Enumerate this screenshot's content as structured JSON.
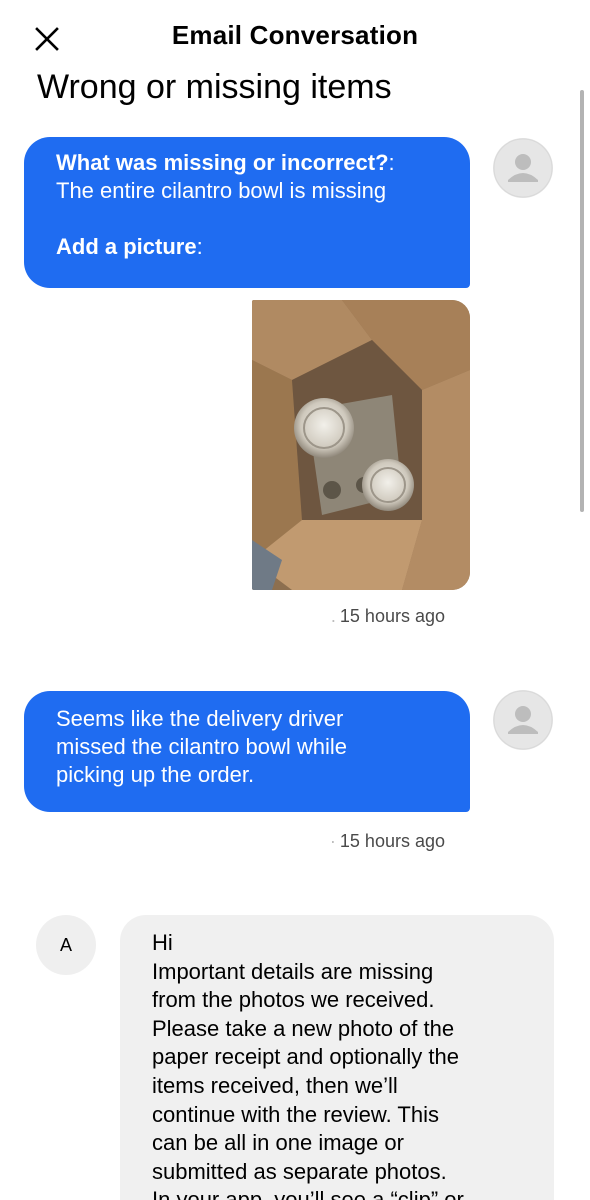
{
  "header": {
    "title": "Email Conversation",
    "close_icon": "close-icon"
  },
  "conversation": {
    "title": "Wrong or missing items"
  },
  "messages": [
    {
      "sender": "user",
      "q_label": "What was missing or incorrect?",
      "q_colon": ":",
      "answer": "The entire cilantro bowl is missing",
      "pic_label": "Add a picture",
      "pic_colon": ":",
      "avatar_icon": "person-icon",
      "photo_icon": "delivery-bag-photo",
      "time": "15 hours ago"
    },
    {
      "sender": "user",
      "lines": [
        "Seems like the delivery driver",
        "missed the cilantro bowl while",
        "picking up the order."
      ],
      "avatar_icon": "person-icon",
      "time": "15 hours ago"
    },
    {
      "sender": "agent",
      "avatar_letter": "A",
      "lines": [
        "Hi",
        "Important details are missing",
        "from the photos we received.",
        "Please take a new photo of the",
        "paper receipt and optionally the",
        "items received, then we’ll",
        "continue with the review. This",
        "can be all in one image or",
        "submitted as separate photos.",
        "In your app, you’ll see a “clip” or"
      ]
    }
  ],
  "colors": {
    "sent_bubble": "#1f6cf1",
    "received_bubble": "#f0f0f0"
  }
}
